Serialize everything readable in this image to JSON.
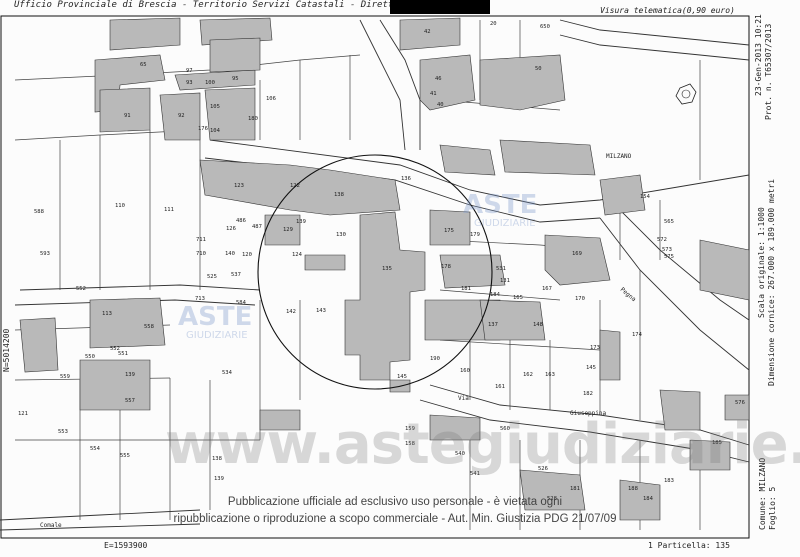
{
  "header": {
    "office": "Ufficio Provinciale di Brescia - Territorio Servizi Catastali - Direttore",
    "visura": "Visura telematica(0,90 euro)"
  },
  "side_right": {
    "date": "23-Gen-2013 10:21",
    "prot": "Prot. n. T65307/2013",
    "scale": "Scala originale: 1:1000",
    "dims": "Dimensione cornice: 267.000 x 189.000 metri",
    "comune": "Comune: MILZANO",
    "foglio": "Foglio: 5"
  },
  "side_left": {
    "north": "N=5014200"
  },
  "footer": {
    "east": "E=1593900",
    "particella": "1 Particella: 135"
  },
  "streets": {
    "milzano": "MILZANO",
    "via": "Via",
    "giuseppina": "Giuseppina",
    "comale": "Comale",
    "pegna": "Pegna"
  },
  "watermark": {
    "site": "www.astegiudiziarie.it",
    "aste": "ASTE",
    "giudiziarie": "GIUDIZIARIE"
  },
  "notice": {
    "line1": "Pubblicazione ufficiale ad esclusivo uso personale - è vietata ogni",
    "line2": "ripubblicazione o riproduzione a scopo commerciale - Aut. Min. Giustizia PDG 21/07/09"
  },
  "parcels": [
    "65",
    "97",
    "93",
    "100",
    "95",
    "106",
    "91",
    "92",
    "105",
    "180",
    "176",
    "104",
    "588",
    "110",
    "111",
    "593",
    "123",
    "122",
    "126",
    "120",
    "139",
    "130",
    "135",
    "136",
    "138",
    "486",
    "487",
    "129",
    "711",
    "124",
    "140",
    "710",
    "525",
    "537",
    "713",
    "584",
    "142",
    "143",
    "534",
    "552",
    "113",
    "558",
    "552",
    "139",
    "559",
    "557",
    "550",
    "551",
    "121",
    "553",
    "554",
    "555",
    "138",
    "139",
    "190",
    "145",
    "175",
    "179",
    "178",
    "531",
    "181",
    "184",
    "165",
    "167",
    "169",
    "170",
    "173",
    "174",
    "154",
    "159",
    "158",
    "160",
    "161",
    "162",
    "163",
    "145",
    "181",
    "182",
    "526",
    "528",
    "565",
    "572",
    "573",
    "575",
    "576",
    "185",
    "184",
    "183",
    "188",
    "137",
    "131",
    "148",
    "560",
    "540",
    "541",
    "46",
    "41",
    "40",
    "650",
    "20",
    "50",
    "42"
  ]
}
